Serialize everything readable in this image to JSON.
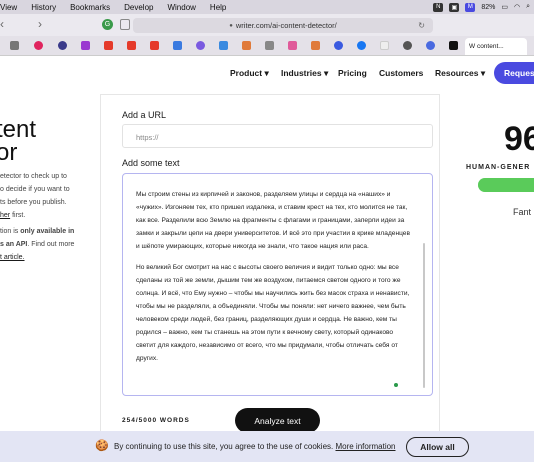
{
  "menubar": {
    "items": [
      "View",
      "History",
      "Bookmarks",
      "Develop",
      "Window",
      "Help"
    ],
    "status": {
      "battery": "82%"
    }
  },
  "browser": {
    "url": "writer.com/ai-content-detector/",
    "active_tab_title": "W content..."
  },
  "site_nav": {
    "items": [
      "Product ▾",
      "Industries ▾",
      "Pricing",
      "Customers",
      "Resources ▾"
    ],
    "cta": "Request"
  },
  "hero": {
    "title_line1": "tent",
    "title_line2": "or",
    "desc_lines": [
      "etector to check up to",
      "o decide if you want to",
      "ts before you publish.",
      "first."
    ],
    "desc_link": "her",
    "api_line1_prefix": "tion is ",
    "api_line1_bold": "only available in",
    "api_line2_bold": "s an API",
    "api_line2_suffix": ". Find out more",
    "api_link": "t article."
  },
  "form": {
    "url_label": "Add a URL",
    "url_placeholder": "https://",
    "text_label": "Add some text",
    "text_paragraphs": [
      "Мы строим стены из кирпичей и законов, разделяем улицы и сердца на «наших» и «чужих». Изгоняем тех, кто пришел издалека, и ставим крест на тех, кто молится не так, как все. Разделили всю Землю на фрагменты с флагами и границами, заперли идеи за замки и закрыли цепи на двери университетов. И всё это при участии в крике младенцев и шёпоте умирающих, которые никогда не знали, что такое нация или раса.",
      "Но великий Бог смотрит на нас с высоты своего величия и видит только одно: мы все сделаны из той же земли, дышим тем же воздухом, питаемся светом одного и того же солнца. И всё, что Ему нужно – чтобы мы научились жить без масок страха и ненависти, чтобы мы не разделяли, а объединяли. Чтобы мы поняли: нет ничего важнее, чем быть человеком среди людей, без границ, разделяющих души и сердца. Не важно, кем ты родился – важно, кем ты станешь на этом пути к вечному свету, который одинаково светит для каждого, независимо от всего, что мы придумали, чтобы отличать себя от других."
    ],
    "word_count": "254/5000 WORDS",
    "analyze_label": "Analyze text"
  },
  "result": {
    "score": "96",
    "score_label": "HUMAN-GENER",
    "score_fraction": 0.96,
    "verdict": "Fant"
  },
  "cookie": {
    "text": "By continuing to use this site, you agree to the use of cookies.",
    "link": "More information",
    "button": "Allow all"
  },
  "colors": {
    "accent": "#4a4ae0",
    "score_green": "#5acb5a",
    "cookie_bg": "#e3e5f4"
  }
}
